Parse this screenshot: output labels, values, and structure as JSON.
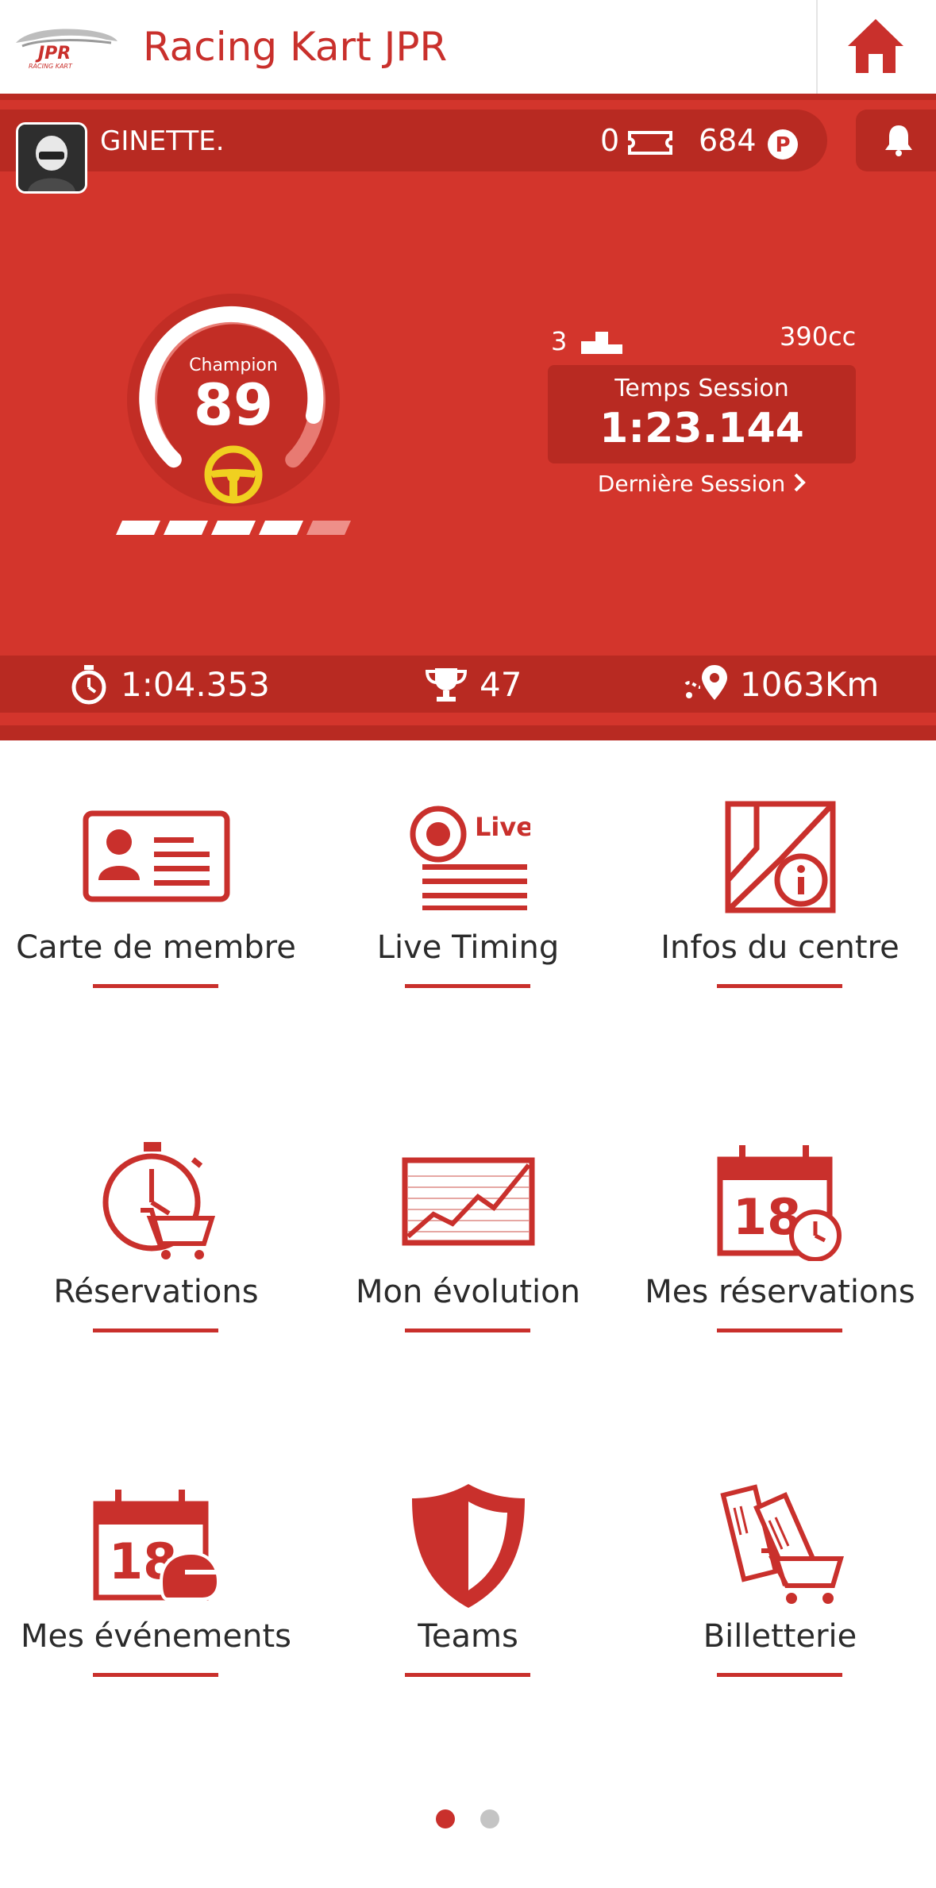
{
  "header": {
    "app_title": "Racing Kart JPR",
    "logo_icon": "jpr-racing-kart-logo",
    "home_icon": "home-icon"
  },
  "profile": {
    "username": "GINETTE.",
    "tickets": "0",
    "points": "684",
    "rank_label": "Champion",
    "rank_value": "89",
    "level_progress_segments_filled": 4,
    "level_progress_segments_total": 5,
    "podiums": "3",
    "engine": "390cc",
    "session_title": "Temps Session",
    "session_time": "1:23.144",
    "last_session_label": "Dernière Session"
  },
  "stats": {
    "best_lap": "1:04.353",
    "trophies": "47",
    "distance": "1063Km"
  },
  "menu": [
    {
      "label": "Carte de membre",
      "icon": "member-card-icon"
    },
    {
      "label": "Live Timing",
      "icon": "live-timing-icon",
      "badge": "Live"
    },
    {
      "label": "Infos du centre",
      "icon": "center-info-icon"
    },
    {
      "label": "Réservations",
      "icon": "stopwatch-cart-icon"
    },
    {
      "label": "Mon évolution",
      "icon": "evolution-chart-icon"
    },
    {
      "label": "Mes réservations",
      "icon": "calendar-stopwatch-icon",
      "date": "18"
    },
    {
      "label": "Mes événements",
      "icon": "calendar-helmet-icon",
      "date": "18"
    },
    {
      "label": "Teams",
      "icon": "shield-icon"
    },
    {
      "label": "Billetterie",
      "icon": "tickets-cart-icon"
    }
  ],
  "pager": {
    "current": 1,
    "total": 2
  },
  "colors": {
    "primary": "#d3352c",
    "dark": "#b82a22",
    "text": "#2b2b2b",
    "wheel": "#f0d020"
  }
}
